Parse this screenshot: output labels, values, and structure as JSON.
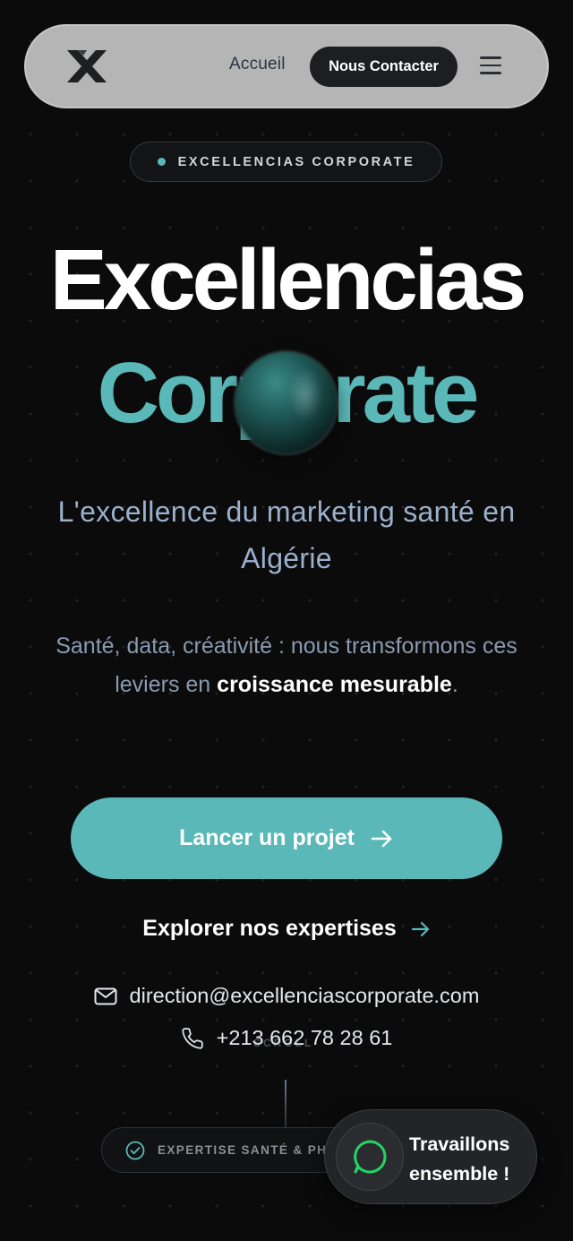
{
  "nav": {
    "logo_icon": "x-logo-icon",
    "home_label": "Accueil",
    "contact_label": "Nous Contacter",
    "menu_icon": "hamburger-menu-icon"
  },
  "badge": {
    "label": "EXCELLENCIAS CORPORATE"
  },
  "hero": {
    "title_line1": "Excellencias",
    "title_line2": "Corporate",
    "subtitle": "L'excellence du marketing santé en Algérie",
    "description_start": "Santé, data, créativité : nous transformons ces leviers en ",
    "description_strong": "croissance mesurable",
    "description_end": "."
  },
  "actions": {
    "primary_label": "Lancer un projet",
    "secondary_label": "Explorer nos expertises"
  },
  "contact": {
    "email": "direction@excellenciascorporate.com",
    "phone": "+213 662 78 28 61"
  },
  "scroll_hint": "SCROLL",
  "chip": {
    "label": "EXPERTISE SANTÉ & PHARMA"
  },
  "whatsapp": {
    "label_line1": "Travaillons",
    "label_line2": "ensemble !"
  },
  "colors": {
    "background": "#0b0b0c",
    "accent": "#5bb8b8",
    "nav_bg": "#b5b5b5",
    "whatsapp_green": "#25d366"
  }
}
